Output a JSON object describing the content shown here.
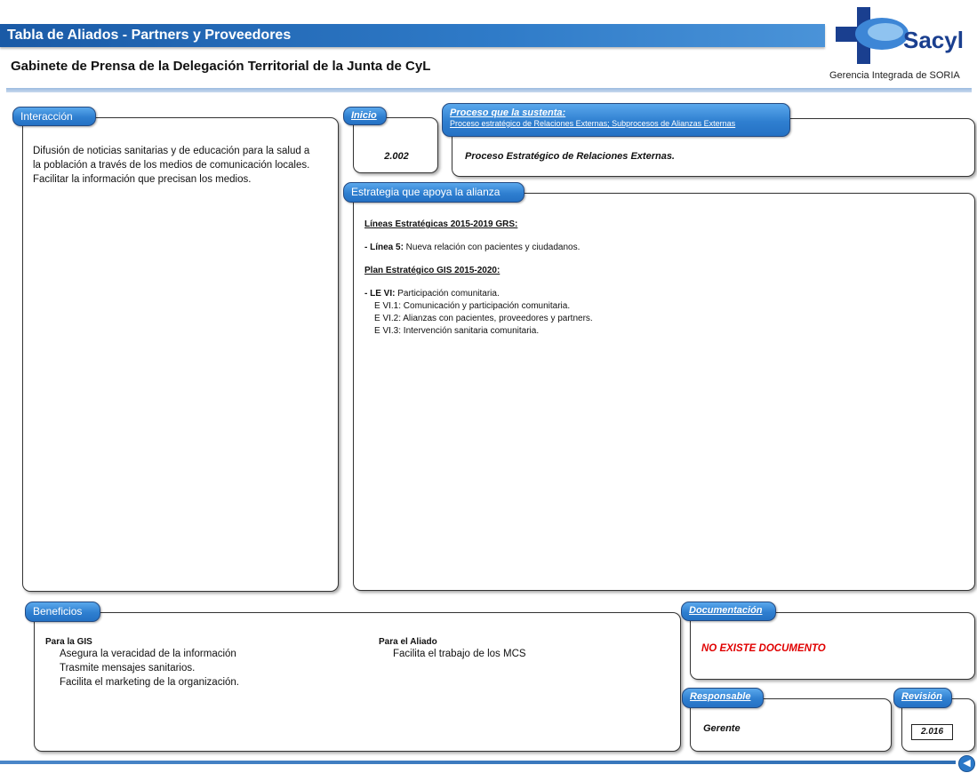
{
  "header": {
    "title": "Tabla de Aliados - Partners y Proveedores",
    "subtitle": "Gabinete de Prensa de la Delegación Territorial de la Junta de CyL",
    "logo_text": "Sacyl",
    "org": "Gerencia Integrada de SORIA"
  },
  "interaccion": {
    "label": "Interacción",
    "lines": [
      "Difusión de noticias sanitarias y de educación para la salud a",
      "la población a través de los medios de comunicación locales.",
      "Facilitar la información que precisan los medios."
    ]
  },
  "inicio": {
    "label": "Inicio",
    "value": "2.002"
  },
  "proceso": {
    "label": "Proceso que la sustenta",
    "label_suffix": ":",
    "sublabel": "Proceso estratégico de Relaciones Externas; Subprocesos de Alianzas Externas",
    "value": "Proceso Estratégico de Relaciones Externas."
  },
  "estrategia": {
    "label": "Estrategia que apoya la alianza",
    "heading1": "Líneas Estratégicas 2015-2019  GRS:",
    "linea5_prefix": "- Línea 5:",
    "linea5_text": " Nueva relación con pacientes y ciudadanos.",
    "heading2": "Plan Estratégico GIS 2015-2020:",
    "levi_prefix": " - LE VI:",
    "levi_text": " Participación comunitaria.",
    "items": [
      "E VI.1: Comunicación y participación comunitaria.",
      "E VI.2: Alianzas con pacientes, proveedores y partners.",
      "E VI.3: Intervención sanitaria comunitaria."
    ]
  },
  "beneficios": {
    "label": "Beneficios",
    "gis_heading": "Para la GIS",
    "gis_items": [
      "Asegura la veracidad de la información",
      "Trasmite mensajes sanitarios.",
      "Facilita el marketing de la organización."
    ],
    "aliado_heading": "Para el Aliado",
    "aliado_items": [
      "Facilita el trabajo de los MCS"
    ]
  },
  "documentacion": {
    "label": "Documentación",
    "value": "NO EXISTE DOCUMENTO"
  },
  "responsable": {
    "label": "Responsable",
    "value": "Gerente"
  },
  "revision": {
    "label": "Revisión",
    "value": "2.016"
  },
  "colors": {
    "accent": "#2f7fd0",
    "title_bar": "#1a5aa6",
    "warning": "#e00000"
  },
  "icons": {
    "back": "back-arrow-icon"
  }
}
